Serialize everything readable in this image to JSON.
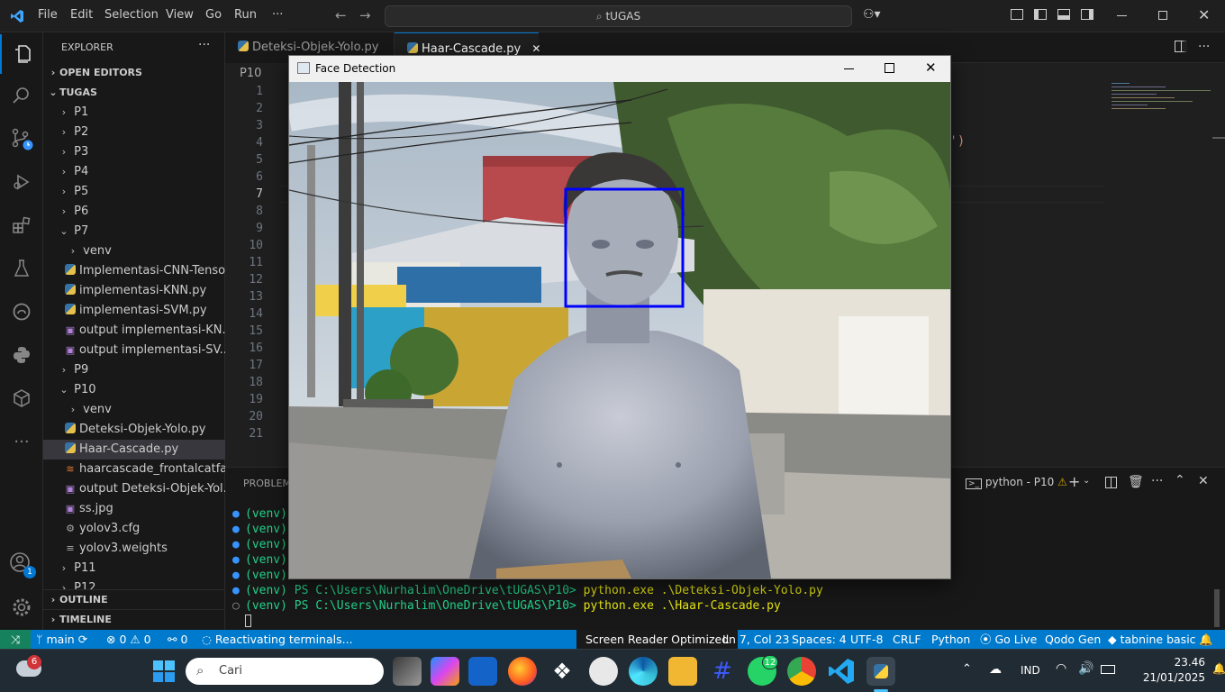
{
  "titlebar": {
    "menu": [
      "File",
      "Edit",
      "Selection",
      "View",
      "Go",
      "Run",
      "···"
    ],
    "search": "tUGAS"
  },
  "explorer": {
    "title": "EXPLORER",
    "more": "···",
    "open_editors": "OPEN EDITORS",
    "root": "TUGAS",
    "items": [
      "P1",
      "P2",
      "P3",
      "P4",
      "P5",
      "P6",
      "P7",
      "venv",
      "Implementasi-CNN-Tenso...",
      "implementasi-KNN.py",
      "implementasi-SVM.py",
      "output implementasi-KN...",
      "output implementasi-SV...",
      "P9",
      "P10",
      "venv",
      "Deteksi-Objek-Yolo.py",
      "Haar-Cascade.py",
      "haarcascade_frontalcatfac...",
      "output Deteksi-Objek-Yol...",
      "ss.jpg",
      "yolov3.cfg",
      "yolov3.weights",
      "P11",
      "P12"
    ],
    "outline": "OUTLINE",
    "timeline": "TIMELINE"
  },
  "tabs": [
    {
      "label": "Deteksi-Objek-Yolo.py"
    },
    {
      "label": "Haar-Cascade.py",
      "close": "✕"
    }
  ],
  "breadcrumb": "P10",
  "line_numbers": [
    "1",
    "2",
    "3",
    "4",
    "5",
    "6",
    "7",
    "8",
    "9",
    "10",
    "11",
    "12",
    "13",
    "14",
    "15",
    "16",
    "17",
    "18",
    "19",
    "20",
    "21"
  ],
  "code_fragment": "l')",
  "panel": {
    "tab": "PROBLEMS",
    "terminal_name": "python - P10",
    "lines": [
      "(venv)",
      "(venv)",
      "(venv)",
      "(venv)",
      "(venv)"
    ],
    "cmd1_prompt": "(venv) PS C:\\Users\\Nurhalim\\OneDrive\\tUGAS\\P10>",
    "cmd1": " python.exe .\\Deteksi-Objek-Yolo.py",
    "cmd2_prompt": "(venv) PS C:\\Users\\Nurhalim\\OneDrive\\tUGAS\\P10>",
    "cmd2": " python.exe .\\Haar-Cascade.py"
  },
  "activity_badge": "1",
  "statusbar": {
    "branch": "main",
    "errors": "0",
    "warnings": "0",
    "ports": "0",
    "activity": "Reactivating terminals...",
    "screen_reader": "Screen Reader Optimized",
    "position": "Ln 7, Col 23",
    "spaces": "Spaces: 4",
    "encoding": "UTF-8",
    "eol": "CRLF",
    "language": "Python",
    "golive": "Go Live",
    "qodo": "Qodo Gen",
    "tabnine": "tabnine basic"
  },
  "face_window": {
    "title": "Face Detection",
    "detection_color": "#0000ff"
  },
  "taskbar": {
    "weather_badge": "6",
    "search": "Cari",
    "whatsapp_badge": "12",
    "lang": "IND",
    "time": "23.46",
    "date": "21/01/2025"
  },
  "colors": {
    "statusbar": "#007acc",
    "accent": "#0078d4",
    "terminal_green": "#23d18b",
    "terminal_yellow": "#e5e510"
  }
}
